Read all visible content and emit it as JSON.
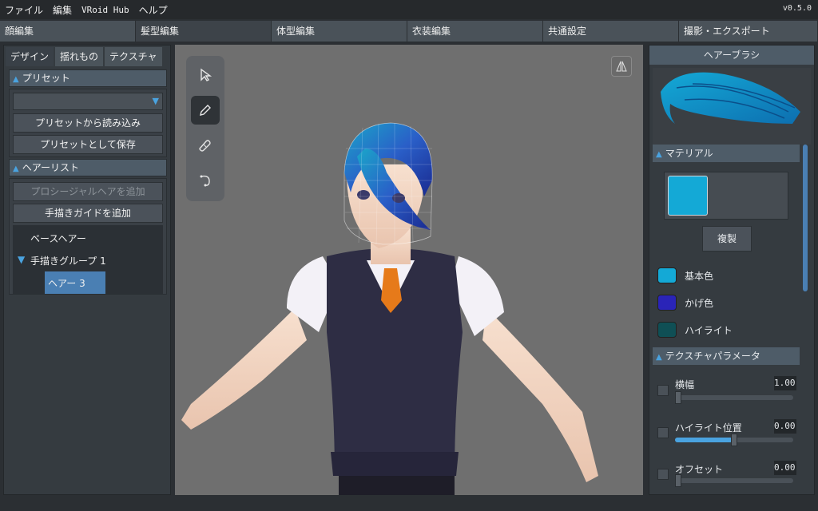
{
  "menu": {
    "items": [
      "ファイル",
      "編集",
      "VRoid Hub",
      "ヘルプ"
    ],
    "version": "v0.5.0"
  },
  "tabs": [
    "顔編集",
    "髪型編集",
    "体型編集",
    "衣装編集",
    "共通設定",
    "撮影・エクスポート"
  ],
  "left": {
    "subtabs": [
      "デザイン",
      "揺れもの",
      "テクスチャ"
    ],
    "preset": {
      "title": "プリセット",
      "dropdown_value": "",
      "load_btn": "プリセットから読み込み",
      "save_btn": "プリセットとして保存"
    },
    "hairlist": {
      "title": "ヘアーリスト",
      "add_procedural": "プロシージャルヘアを追加",
      "add_guide": "手描きガイドを追加",
      "items": [
        "ベースヘアー",
        "手描きグループ 1",
        "ヘアー 3"
      ]
    }
  },
  "right": {
    "title": "ヘアーブラシ",
    "material": {
      "title": "マテリアル",
      "copy_btn": "複製",
      "colors": [
        {
          "label": "基本色",
          "color": "#14a9d6"
        },
        {
          "label": "かげ色",
          "color": "#2a24b8"
        },
        {
          "label": "ハイライト",
          "color": "#0f4f55"
        }
      ]
    },
    "texture_params": {
      "title": "テクスチャパラメータ",
      "params": [
        {
          "label": "横幅",
          "value": "1.00",
          "level": 0.0
        },
        {
          "label": "ハイライト位置",
          "value": "0.00",
          "level": 0.5
        },
        {
          "label": "オフセット",
          "value": "0.00",
          "level": 0.0
        }
      ]
    }
  },
  "icons": {
    "select": "cursor-icon",
    "pen": "pen-icon",
    "eraser": "eraser-icon",
    "curve": "curve-icon",
    "mirror": "mirror-icon"
  }
}
